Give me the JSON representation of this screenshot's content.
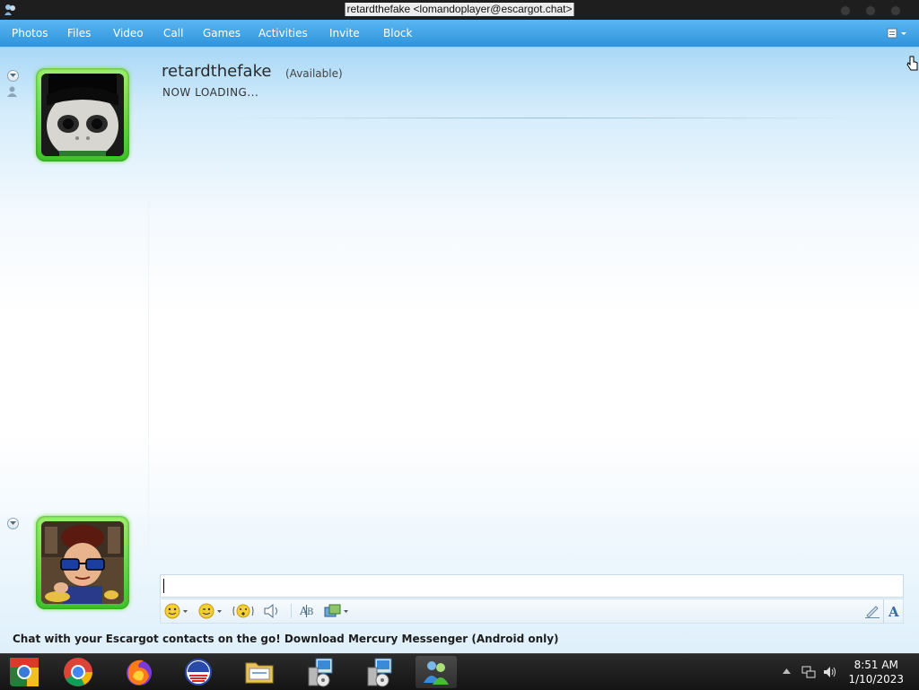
{
  "window": {
    "title": "retardthefake <lomandoplayer@escargot.chat>"
  },
  "menu": {
    "items": [
      "Photos",
      "Files",
      "Video",
      "Call",
      "Games",
      "Activities",
      "Invite",
      "Block"
    ]
  },
  "contact": {
    "name": "retardthefake",
    "status": "(Available)",
    "personal_message": "NOW LOADING..."
  },
  "compose": {
    "input_value": ""
  },
  "banner": {
    "text": "Chat with your Escargot contacts on the go! Download Mercury Messenger (Android only)"
  },
  "taskbar": {
    "apps": [
      "chrome-os-icon",
      "chrome-icon",
      "firefox-icon",
      "obama-logo-icon",
      "file-manager-icon",
      "messenger-setup-icon",
      "messenger-setup-icon",
      "messenger-buddies-icon"
    ],
    "clock": {
      "time": "8:51 AM",
      "date": "1/10/2023"
    }
  },
  "colors": {
    "menubar": "#2f93dc",
    "avatar_frame": "#3fc12a",
    "taskbar": "#1e1e1e"
  }
}
